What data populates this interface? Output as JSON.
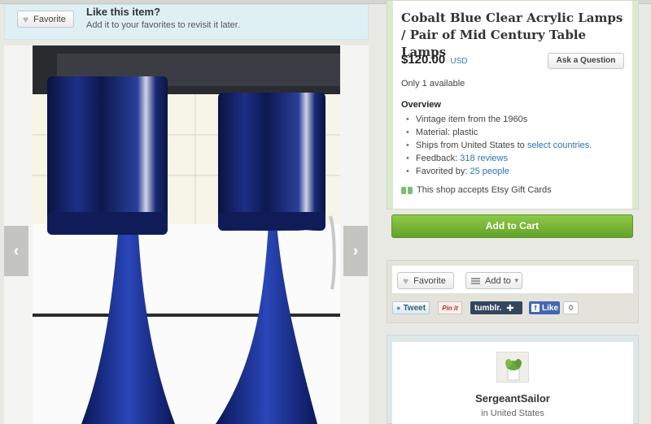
{
  "favorite_banner": {
    "button_label": "Favorite",
    "title": "Like this item?",
    "subtitle": "Add it to your favorites to revisit it later."
  },
  "listing": {
    "title": "Cobalt Blue Clear Acrylic Lamps / Pair of Mid Century Table Lamps",
    "price": "$120.00",
    "currency": "USD",
    "ask_button": "Ask a Question",
    "availability": "Only 1 available",
    "overview_heading": "Overview",
    "overview": {
      "vintage": "Vintage item from the 1960s",
      "material": "Material: plastic",
      "ships_prefix": "Ships from United States to",
      "ships_link": "select countries.",
      "feedback_prefix": "Feedback:",
      "feedback_link": "318 reviews",
      "favorited_prefix": "Favorited by:",
      "favorited_link": "25 people"
    },
    "gift_cards": "This shop accepts Etsy Gift Cards",
    "add_to_cart": "Add to Cart"
  },
  "social": {
    "favorite_label": "Favorite",
    "add_to_label": "Add to",
    "tweet": "Tweet",
    "pinit": "Pin it",
    "tumblr": "tumblr.",
    "fb_like": "Like",
    "fb_count": "0"
  },
  "shop": {
    "name": "SergeantSailor",
    "location": "in United States"
  },
  "colors": {
    "accent_green": "#6aab30",
    "link_blue": "#2b74b3",
    "lamp_blue": "#0e1f63"
  }
}
